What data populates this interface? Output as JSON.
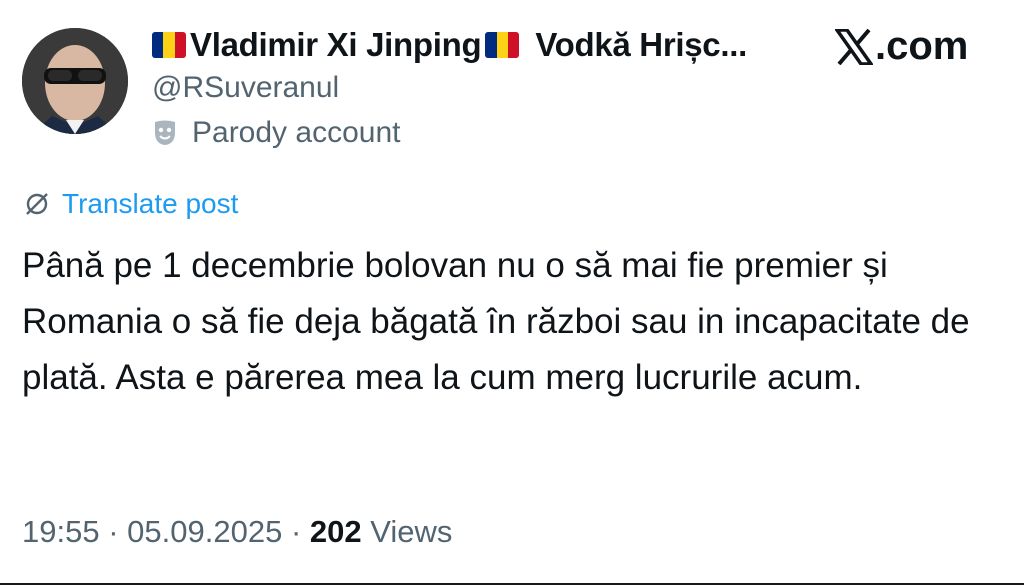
{
  "author": {
    "name_part1": "Vladimir Xi Jinping",
    "name_part2": "Vodkă Hrișc...",
    "handle": "@RSuveranul",
    "label": "Parody account",
    "flag_colors": [
      "#002b7f",
      "#fcd116",
      "#ce1126"
    ]
  },
  "brand": {
    "logo_text": ".com"
  },
  "post": {
    "translate_label": "Translate post",
    "text": "Până pe 1 decembrie bolovan nu o să mai fie premier și Romania o să fie deja băgată în război sau in incapacitate de plată. Asta e părerea mea la cum merg lucrurile acum."
  },
  "meta": {
    "time": "19:55",
    "separator": "·",
    "date": "05.09.2025",
    "views_count": "202",
    "views_label": "Views"
  },
  "colors": {
    "link": "#1d9bf0",
    "secondary_text": "#536471",
    "primary_text": "#0f1419"
  },
  "icons": {
    "parody": "theater-mask-icon",
    "translate": "globe-slash-icon",
    "brand": "x-logo-icon"
  }
}
